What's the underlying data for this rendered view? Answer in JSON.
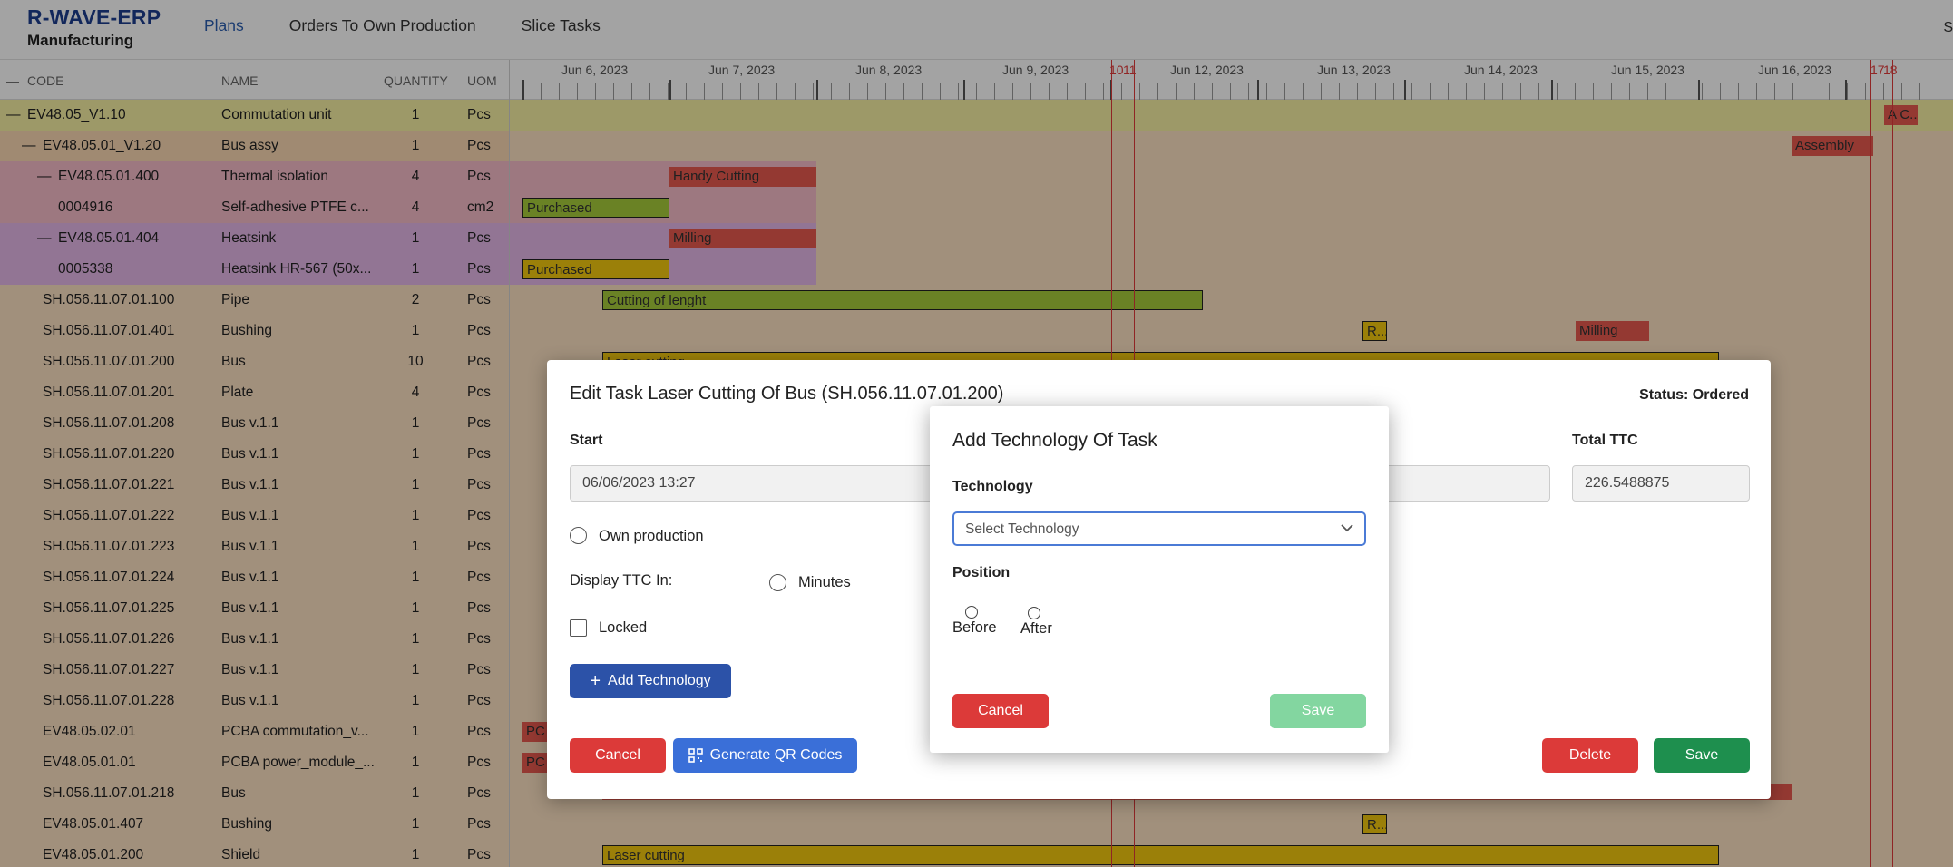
{
  "app": {
    "title": "R-WAVE-ERP",
    "module": "Manufacturing",
    "user_initial": "S"
  },
  "nav": {
    "plans": "Plans",
    "orders": "Orders To Own Production",
    "slice": "Slice Tasks"
  },
  "columns": {
    "collapse": "—",
    "code": "CODE",
    "name": "NAME",
    "quantity": "QUANTITY",
    "uom": "UOM"
  },
  "rows": [
    {
      "code": "EV48.05_V1.10",
      "name": "Commutation unit",
      "qty": "1",
      "uom": "Pcs",
      "toggle": "—"
    },
    {
      "code": "EV48.05.01_V1.20",
      "name": "Bus assy",
      "qty": "1",
      "uom": "Pcs",
      "toggle": "—"
    },
    {
      "code": "EV48.05.01.400",
      "name": "Thermal isolation",
      "qty": "4",
      "uom": "Pcs",
      "toggle": "—"
    },
    {
      "code": "0004916",
      "name": "Self-adhesive PTFE c...",
      "qty": "4",
      "uom": "cm2",
      "toggle": ""
    },
    {
      "code": "EV48.05.01.404",
      "name": "Heatsink",
      "qty": "1",
      "uom": "Pcs",
      "toggle": "—"
    },
    {
      "code": "0005338",
      "name": "Heatsink HR-567 (50x...",
      "qty": "1",
      "uom": "Pcs",
      "toggle": ""
    },
    {
      "code": "SH.056.11.07.01.100",
      "name": "Pipe",
      "qty": "2",
      "uom": "Pcs",
      "toggle": ""
    },
    {
      "code": "SH.056.11.07.01.401",
      "name": "Bushing",
      "qty": "1",
      "uom": "Pcs",
      "toggle": ""
    },
    {
      "code": "SH.056.11.07.01.200",
      "name": "Bus",
      "qty": "10",
      "uom": "Pcs",
      "toggle": ""
    },
    {
      "code": "SH.056.11.07.01.201",
      "name": "Plate",
      "qty": "4",
      "uom": "Pcs",
      "toggle": ""
    },
    {
      "code": "SH.056.11.07.01.208",
      "name": "Bus v.1.1",
      "qty": "1",
      "uom": "Pcs",
      "toggle": ""
    },
    {
      "code": "SH.056.11.07.01.220",
      "name": "Bus v.1.1",
      "qty": "1",
      "uom": "Pcs",
      "toggle": ""
    },
    {
      "code": "SH.056.11.07.01.221",
      "name": "Bus v.1.1",
      "qty": "1",
      "uom": "Pcs",
      "toggle": ""
    },
    {
      "code": "SH.056.11.07.01.222",
      "name": "Bus v.1.1",
      "qty": "1",
      "uom": "Pcs",
      "toggle": ""
    },
    {
      "code": "SH.056.11.07.01.223",
      "name": "Bus v.1.1",
      "qty": "1",
      "uom": "Pcs",
      "toggle": ""
    },
    {
      "code": "SH.056.11.07.01.224",
      "name": "Bus v.1.1",
      "qty": "1",
      "uom": "Pcs",
      "toggle": ""
    },
    {
      "code": "SH.056.11.07.01.225",
      "name": "Bus v.1.1",
      "qty": "1",
      "uom": "Pcs",
      "toggle": ""
    },
    {
      "code": "SH.056.11.07.01.226",
      "name": "Bus v.1.1",
      "qty": "1",
      "uom": "Pcs",
      "toggle": ""
    },
    {
      "code": "SH.056.11.07.01.227",
      "name": "Bus v.1.1",
      "qty": "1",
      "uom": "Pcs",
      "toggle": ""
    },
    {
      "code": "SH.056.11.07.01.228",
      "name": "Bus v.1.1",
      "qty": "1",
      "uom": "Pcs",
      "toggle": ""
    },
    {
      "code": "EV48.05.02.01",
      "name": "PCBA commutation_v...",
      "qty": "1",
      "uom": "Pcs",
      "toggle": ""
    },
    {
      "code": "EV48.05.01.01",
      "name": "PCBA power_module_...",
      "qty": "1",
      "uom": "Pcs",
      "toggle": ""
    },
    {
      "code": "SH.056.11.07.01.218",
      "name": "Bus",
      "qty": "1",
      "uom": "Pcs",
      "toggle": ""
    },
    {
      "code": "EV48.05.01.407",
      "name": "Bushing",
      "qty": "1",
      "uom": "Pcs",
      "toggle": ""
    },
    {
      "code": "EV48.05.01.200",
      "name": "Shield",
      "qty": "1",
      "uom": "Pcs",
      "toggle": ""
    }
  ],
  "timeline": {
    "dates": [
      "Jun 6, 2023",
      "Jun 7, 2023",
      "Jun 8, 2023",
      "Jun 9, 2023",
      "Jun 12, 2023",
      "Jun 13, 2023",
      "Jun 14, 2023",
      "Jun 15, 2023",
      "Jun 16, 2023"
    ],
    "marker_a": "10",
    "marker_b": "11",
    "marker_c": "17",
    "marker_d": "18"
  },
  "gantt_bars": {
    "commutation": "A C...",
    "assembly": "Assembly",
    "handy_cutting": "Handy Cutting",
    "purchased_1": "Purchased",
    "milling_1": "Milling",
    "purchased_2": "Purchased",
    "cutting_lenght": "Cutting of lenght",
    "r_1": "R...",
    "milling_2": "Milling",
    "laser_cutting_1": "Laser cutting",
    "pc_1": "PC",
    "pc_2": "PC",
    "r_2": "R...",
    "laser_cutting_2": "Laser cutting"
  },
  "edit_task": {
    "title": "Edit Task Laser Cutting Of Bus (SH.056.11.07.01.200)",
    "status": "Status: Ordered",
    "start_label": "Start",
    "start_value": "06/06/2023 13:27",
    "total_ttc_label": "Total TTC",
    "total_ttc_value": "226.5488875",
    "own_production": "Own production",
    "display_ttc_in": "Display TTC In:",
    "minutes": "Minutes",
    "locked": "Locked",
    "add_technology": "Add Technology",
    "cancel": "Cancel",
    "generate_qr": "Generate QR Codes",
    "delete": "Delete",
    "save": "Save"
  },
  "add_tech_dialog": {
    "title": "Add Technology Of Task",
    "technology_label": "Technology",
    "technology_placeholder": "Select Technology",
    "position_label": "Position",
    "before": "Before",
    "after": "After",
    "cancel": "Cancel",
    "save": "Save"
  },
  "colors": {
    "brand": "#1d3d8f",
    "row_yellow": "#f6f0a3",
    "row_orange": "#fbd8b3",
    "row_pink": "#f6bcc9",
    "row_purple": "#e4b7e8",
    "row_peach": "#fce1c3",
    "bar_yellow": "#f2c80f",
    "bar_green": "#a6cc3a",
    "bar_red": "#e8594f",
    "marker_line": "#e23a3a",
    "danger": "#dc3a39",
    "primary": "#2c52a8",
    "success": "#1e8f4e"
  }
}
